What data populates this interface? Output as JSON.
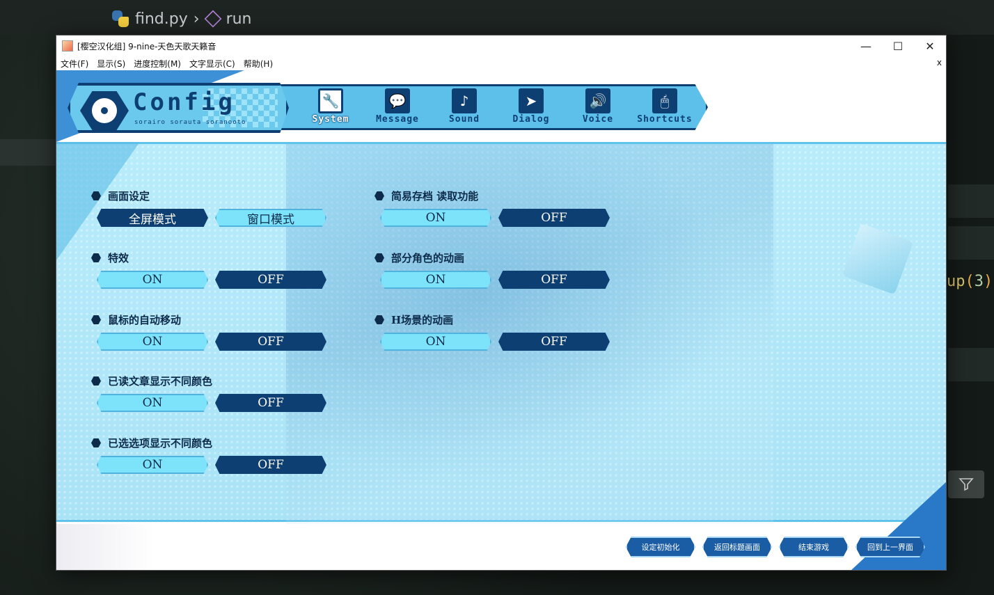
{
  "background": {
    "breadcrumb": {
      "file": "find.py",
      "symbol": "run"
    },
    "code_fragment": {
      "ident": "up",
      "open": "(",
      "num": "3",
      "close": ")"
    }
  },
  "window": {
    "title": "[樱空汉化组] 9-nine-天色天歌天籁音",
    "menu": [
      "文件(F)",
      "显示(S)",
      "进度控制(M)",
      "文字显示(C)",
      "帮助(H)"
    ],
    "menu_close": "x",
    "controls": {
      "minimize": "—",
      "maximize": "☐",
      "close": "✕"
    }
  },
  "header": {
    "title": "Config",
    "subtitle": "sorairo sorauta soranooto",
    "tabs": [
      {
        "label": "System",
        "icon": "wrench-icon",
        "glyph": "🔧",
        "active": true
      },
      {
        "label": "Message",
        "icon": "speech-bubble-icon",
        "glyph": "💬",
        "active": false
      },
      {
        "label": "Sound",
        "icon": "music-note-icon",
        "glyph": "♪",
        "active": false
      },
      {
        "label": "Dialog",
        "icon": "cursor-arrow-icon",
        "glyph": "➤",
        "active": false
      },
      {
        "label": "Voice",
        "icon": "speaker-icon",
        "glyph": "🔊",
        "active": false
      },
      {
        "label": "Shortcuts",
        "icon": "mouse-icon",
        "glyph": "🖱",
        "active": false
      }
    ]
  },
  "settings_left": [
    {
      "label": "画面设定",
      "options": [
        "全屏模式",
        "窗口模式"
      ],
      "selected": 0
    },
    {
      "label": "特效",
      "options": [
        "ON",
        "OFF"
      ],
      "selected": 1
    },
    {
      "label": "鼠标的自动移动",
      "options": [
        "ON",
        "OFF"
      ],
      "selected": 1
    },
    {
      "label": "已读文章显示不同颜色",
      "options": [
        "ON",
        "OFF"
      ],
      "selected": 1
    },
    {
      "label": "已选选项显示不同颜色",
      "options": [
        "ON",
        "OFF"
      ],
      "selected": 1
    }
  ],
  "settings_right": [
    {
      "label": "简易存档 读取功能",
      "options": [
        "ON",
        "OFF"
      ],
      "selected": 1
    },
    {
      "label": "部分角色的动画",
      "options": [
        "ON",
        "OFF"
      ],
      "selected": 1
    },
    {
      "label": "H场景的动画",
      "options": [
        "ON",
        "OFF"
      ],
      "selected": 1
    }
  ],
  "footer": {
    "buttons": [
      "设定初始化",
      "返回标题画面",
      "结束游戏",
      "回到上一界面"
    ]
  },
  "colors": {
    "accent_dark": "#0d3f72",
    "accent_light": "#7de3fa",
    "panel": "#b8ecfb"
  }
}
